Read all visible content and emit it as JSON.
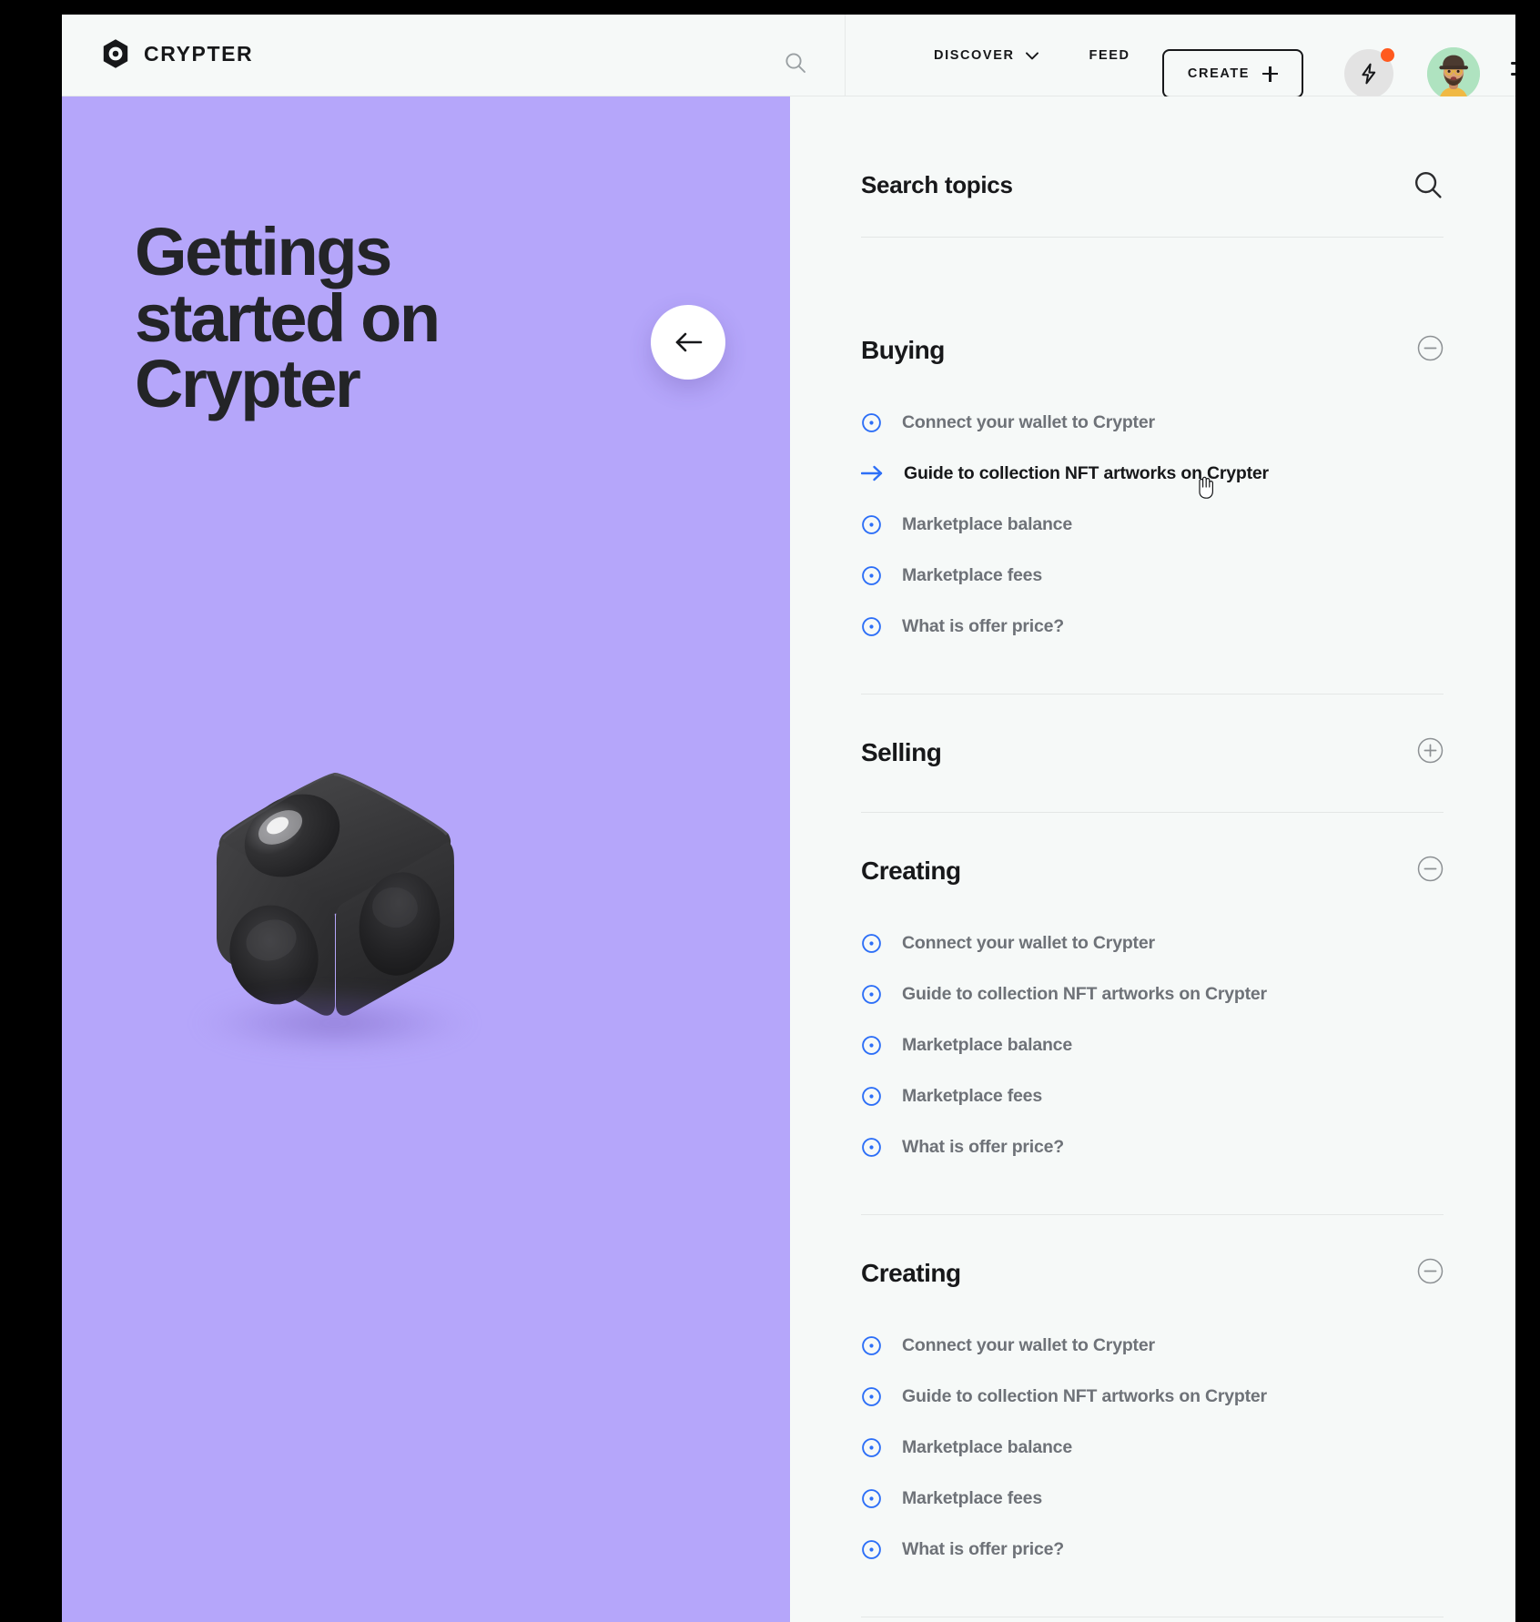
{
  "brand": {
    "name": "CRYPTER"
  },
  "header": {
    "search_icon": "search-icon",
    "nav": [
      {
        "label": "DISCOVER",
        "has_chevron": true
      },
      {
        "label": "FEED",
        "has_chevron": false
      }
    ],
    "create_button": {
      "label": "CREATE",
      "icon": "plus-icon"
    },
    "bolt_button": {
      "icon": "lightning-icon",
      "badge": true
    },
    "avatar": {
      "icon": "user-avatar"
    },
    "menu_button": {
      "icon": "hamburger-icon"
    }
  },
  "hero": {
    "title": "Gettings started on Crypter",
    "back_button_icon": "arrow-left-icon",
    "background_color": "#B5A6FA",
    "artwork": "black-3d-cube"
  },
  "search": {
    "placeholder": "Search topics",
    "icon": "search-icon"
  },
  "sections": [
    {
      "title": "Buying",
      "expanded": true,
      "toggle_icon": "minus-circle-icon",
      "items": [
        {
          "label": "Connect your wallet to Crypter",
          "icon": "dot-circle-icon",
          "active": false
        },
        {
          "label": "Guide to collection NFT artworks on Crypter",
          "icon": "arrow-right-icon",
          "active": true
        },
        {
          "label": "Marketplace balance",
          "icon": "dot-circle-icon",
          "active": false
        },
        {
          "label": "Marketplace fees",
          "icon": "dot-circle-icon",
          "active": false
        },
        {
          "label": "What is offer price?",
          "icon": "dot-circle-icon",
          "active": false
        }
      ]
    },
    {
      "title": "Selling",
      "expanded": false,
      "toggle_icon": "plus-circle-icon",
      "items": []
    },
    {
      "title": "Creating",
      "expanded": true,
      "toggle_icon": "minus-circle-icon",
      "items": [
        {
          "label": "Connect your wallet to Crypter",
          "icon": "dot-circle-icon",
          "active": false
        },
        {
          "label": "Guide to collection NFT artworks on Crypter",
          "icon": "dot-circle-icon",
          "active": false
        },
        {
          "label": "Marketplace balance",
          "icon": "dot-circle-icon",
          "active": false
        },
        {
          "label": "Marketplace fees",
          "icon": "dot-circle-icon",
          "active": false
        },
        {
          "label": "What is offer price?",
          "icon": "dot-circle-icon",
          "active": false
        }
      ]
    },
    {
      "title": "Creating",
      "expanded": true,
      "toggle_icon": "minus-circle-icon",
      "items": [
        {
          "label": "Connect your wallet to Crypter",
          "icon": "dot-circle-icon",
          "active": false
        },
        {
          "label": "Guide to collection NFT artworks on Crypter",
          "icon": "dot-circle-icon",
          "active": false
        },
        {
          "label": "Marketplace balance",
          "icon": "dot-circle-icon",
          "active": false
        },
        {
          "label": "Marketplace fees",
          "icon": "dot-circle-icon",
          "active": false
        },
        {
          "label": "What is offer price?",
          "icon": "dot-circle-icon",
          "active": false
        }
      ]
    }
  ],
  "colors": {
    "accent_blue": "#2D6FF7",
    "hero_purple": "#B5A6FA",
    "badge_orange": "#FF5A1F",
    "panel_bg": "#F6F9F8",
    "text_dark": "#17181A",
    "text_muted": "#6E7278"
  }
}
